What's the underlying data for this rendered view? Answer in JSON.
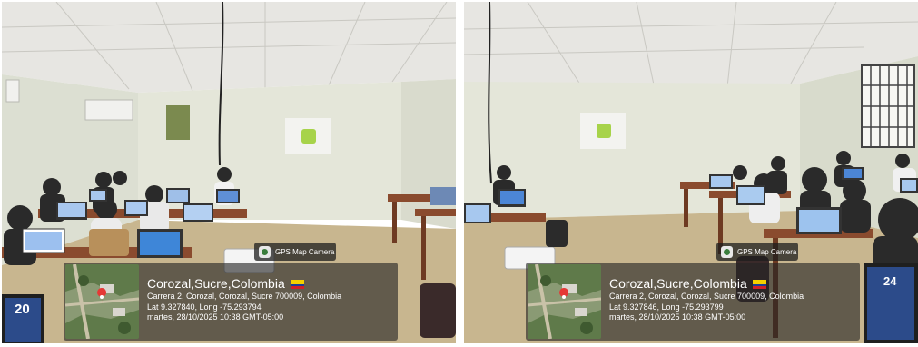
{
  "colors": {
    "ceiling": "#e7e6e2",
    "wall": "#e4e6d9",
    "floor": "#c8b68f",
    "overlay": "#232323",
    "flag_yellow": "#f4d000",
    "flag_blue": "#1c3f94",
    "flag_red": "#cf2028"
  },
  "photos": [
    {
      "gps_tag": {
        "label": "GPS Map Camera",
        "icon": "camera-icon"
      },
      "location_title": "Corozal,Sucre,Colombia",
      "address": "Carrera 2, Corozal, Corozal, Sucre 700009, Colombia",
      "coords": "Lat 9.327840, Long -75.293794",
      "datetime": "martes, 28/10/2025 10:38 GMT-05:00",
      "laptop_badge": "20"
    },
    {
      "gps_tag": {
        "label": "GPS Map Camera",
        "icon": "camera-icon"
      },
      "location_title": "Corozal,Sucre,Colombia",
      "address": "Carrera 2, Corozal, Corozal, Sucre 700009, Colombia",
      "coords": "Lat 9.327846, Long -75.293799",
      "datetime": "martes, 28/10/2025 10:38 GMT-05:00",
      "laptop_badge": "24"
    }
  ]
}
